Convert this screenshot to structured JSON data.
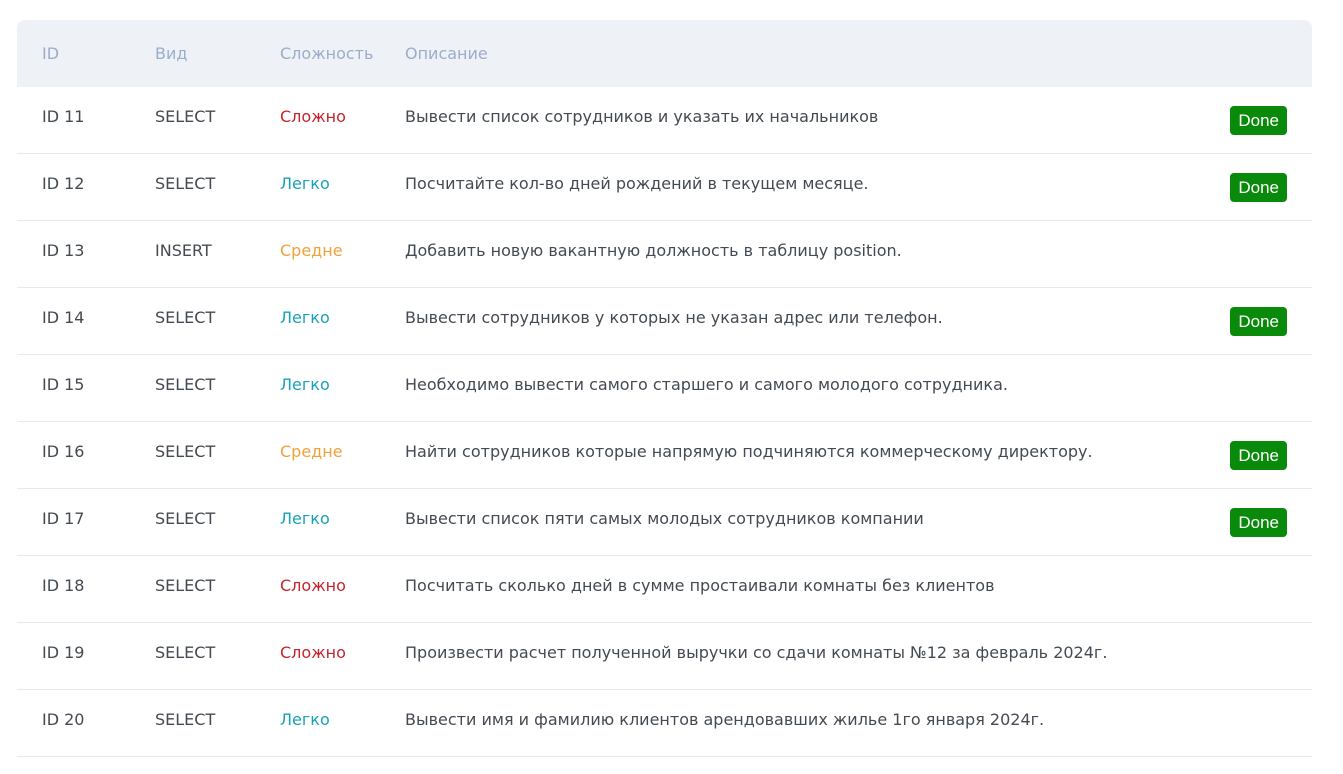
{
  "header": {
    "id": "ID",
    "kind": "Вид",
    "level": "Сложность",
    "description": "Описание"
  },
  "colors": {
    "hard": "#c8232c",
    "easy": "#17a2b8",
    "medium": "#f0a23a",
    "done_badge": "#0a8a0a",
    "header_bg": "#eef1f6"
  },
  "rows": [
    {
      "id": "ID 11",
      "kind": "SELECT",
      "level": "Сложно",
      "level_key": "hard",
      "description": "Вывести список сотрудников и указать их начальников",
      "status": "Done"
    },
    {
      "id": "ID 12",
      "kind": "SELECT",
      "level": "Легко",
      "level_key": "easy",
      "description": "Посчитайте кол-во дней рождений в текущем месяце.",
      "status": "Done"
    },
    {
      "id": "ID 13",
      "kind": "INSERT",
      "level": "Средне",
      "level_key": "medium",
      "description": "Добавить новую вакантную должность в таблицу position.",
      "status": ""
    },
    {
      "id": "ID 14",
      "kind": "SELECT",
      "level": "Легко",
      "level_key": "easy",
      "description": "Вывести сотрудников у которых не указан адрес или телефон.",
      "status": "Done"
    },
    {
      "id": "ID 15",
      "kind": "SELECT",
      "level": "Легко",
      "level_key": "easy",
      "description": "Необходимо вывести самого старшего и самого молодого сотрудника.",
      "status": ""
    },
    {
      "id": "ID 16",
      "kind": "SELECT",
      "level": "Средне",
      "level_key": "medium",
      "description": "Найти сотрудников которые напрямую подчиняются коммерческому директору.",
      "status": "Done"
    },
    {
      "id": "ID 17",
      "kind": "SELECT",
      "level": "Легко",
      "level_key": "easy",
      "description": "Вывести список пяти самых молодых сотрудников компании",
      "status": "Done"
    },
    {
      "id": "ID 18",
      "kind": "SELECT",
      "level": "Сложно",
      "level_key": "hard",
      "description": "Посчитать сколько дней в сумме простаивали комнаты без клиентов",
      "status": ""
    },
    {
      "id": "ID 19",
      "kind": "SELECT",
      "level": "Сложно",
      "level_key": "hard",
      "description": "Произвести расчет полученной выручки со сдачи комнаты №12 за февраль 2024г.",
      "status": ""
    },
    {
      "id": "ID 20",
      "kind": "SELECT",
      "level": "Легко",
      "level_key": "easy",
      "description": "Вывести имя и фамилию клиентов арендовавших жилье 1го января 2024г.",
      "status": ""
    }
  ]
}
